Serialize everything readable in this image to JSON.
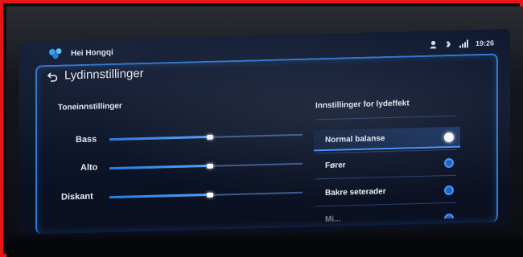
{
  "header": {
    "greeting": "Hei Hongqi"
  },
  "status_bar": {
    "time": "19:26"
  },
  "page": {
    "title": "Lydinnstillinger"
  },
  "tone_settings": {
    "heading": "Toneinnstillinger",
    "sliders": [
      {
        "label": "Bass",
        "value_fraction": 0.52
      },
      {
        "label": "Alto",
        "value_fraction": 0.52
      },
      {
        "label": "Diskant",
        "value_fraction": 0.52
      }
    ]
  },
  "effect_settings": {
    "heading": "Innstillinger for lydeffekt",
    "options": [
      {
        "label": "Normal balanse",
        "selected": true
      },
      {
        "label": "Fører",
        "selected": false
      },
      {
        "label": "Bakre seterader",
        "selected": false
      }
    ],
    "partial_option": {
      "label": "Mi...",
      "selected": false
    }
  },
  "colors": {
    "accent": "#2c79d6",
    "frame_highlight": "#e8141a"
  }
}
